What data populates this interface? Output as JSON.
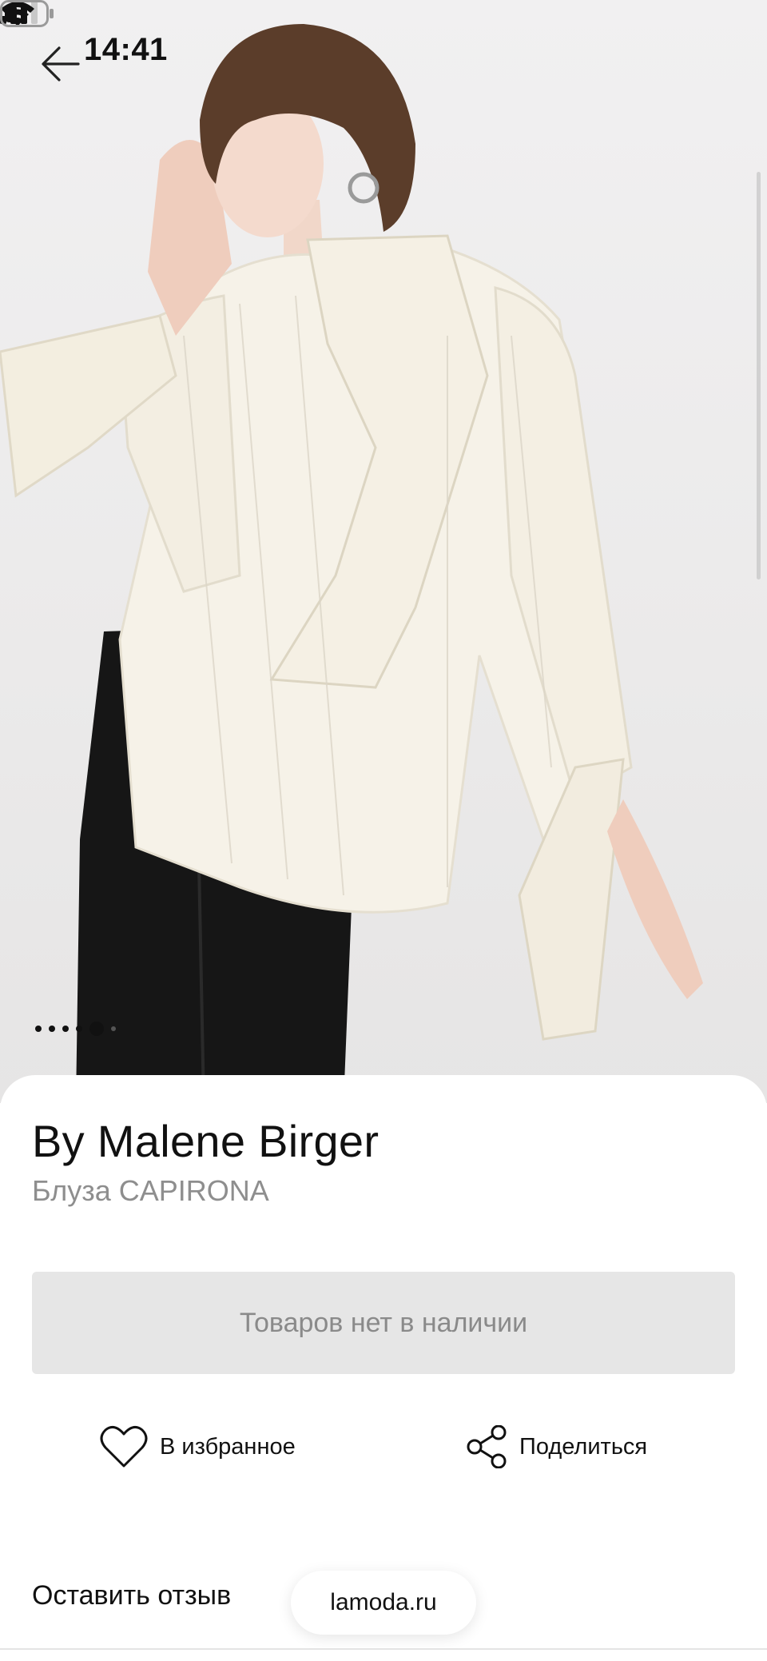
{
  "status_bar": {
    "time": "14:41",
    "icons": [
      "back-arrow-icon",
      "cellular-signal-icon",
      "wifi-icon",
      "battery-icon"
    ],
    "battery_level": 0.3
  },
  "gallery": {
    "image_subject": "model-wearing-cream-blouse",
    "current_index": 5,
    "total": 5
  },
  "product": {
    "brand": "By Malene Birger",
    "name": "Блуза CAPIRONA"
  },
  "buy": {
    "out_of_stock_label": "Товаров нет в наличии"
  },
  "actions": {
    "favorite_label": "В избранное",
    "share_label": "Поделиться"
  },
  "footer": {
    "review_label": "Оставить отзыв",
    "domain": "lamoda.ru"
  },
  "colors": {
    "background": "#ffffff",
    "disabled_button": "#e6e6e6",
    "muted_text": "#8e8e8e",
    "primary_text": "#111111"
  }
}
